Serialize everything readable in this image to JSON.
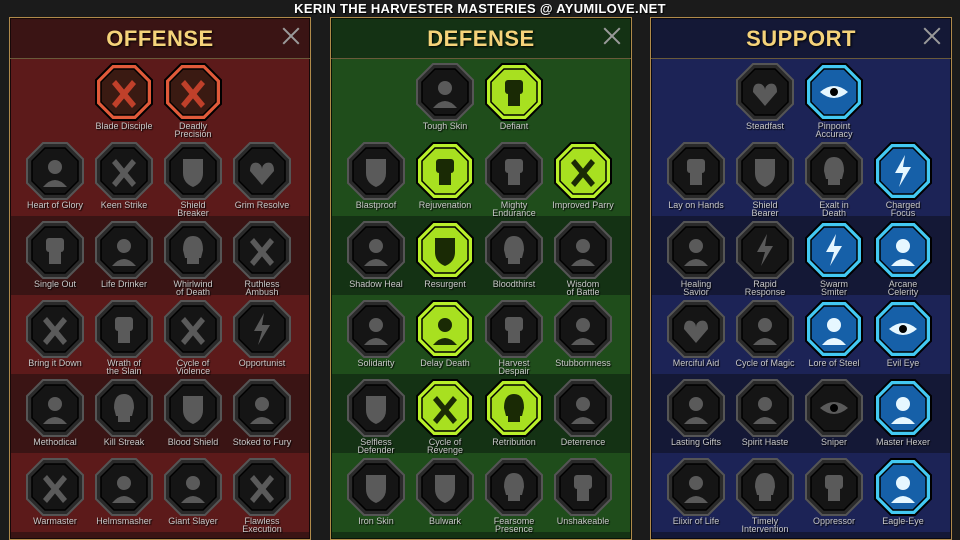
{
  "page_title": "KERIN THE HARVESTER MASTERIES @ AYUMILOVE.NET",
  "panels": [
    {
      "name": "OFFENSE",
      "theme": {
        "bg": "#3a1414",
        "band": "#5c1a1a",
        "accent": "#e05a3a"
      },
      "rows": [
        [
          {
            "label": "Blade Disciple",
            "icon": "crossed-swords-icon",
            "active": true
          },
          {
            "label": "Deadly\nPrecision",
            "icon": "daggers-icon",
            "active": true
          }
        ],
        [
          {
            "label": "Heart of Glory",
            "icon": "horned-warrior-icon",
            "active": false
          },
          {
            "label": "Keen Strike",
            "icon": "slash-icon",
            "active": false
          },
          {
            "label": "Shield\nBreaker",
            "icon": "broken-shield-icon",
            "active": false
          },
          {
            "label": "Grim Resolve",
            "icon": "broken-heart-icon",
            "active": false
          }
        ],
        [
          {
            "label": "Single Out",
            "icon": "target-fist-icon",
            "active": false
          },
          {
            "label": "Life Drinker",
            "icon": "fanged-mouth-icon",
            "active": false
          },
          {
            "label": "Whirlwind\nof Death",
            "icon": "skull-swirl-icon",
            "active": false
          },
          {
            "label": "Ruthless\nAmbush",
            "icon": "raised-blade-icon",
            "active": false
          }
        ],
        [
          {
            "label": "Bring it Down",
            "icon": "sword-down-icon",
            "active": false
          },
          {
            "label": "Wrath of\nthe Slain",
            "icon": "fist-icon",
            "active": false
          },
          {
            "label": "Cycle of\nViolence",
            "icon": "axe-icon",
            "active": false
          },
          {
            "label": "Opportunist",
            "icon": "chain-bolt-icon",
            "active": false
          }
        ],
        [
          {
            "label": "Methodical",
            "icon": "spider-icon",
            "active": false
          },
          {
            "label": "Kill Streak",
            "icon": "skull-icon",
            "active": false
          },
          {
            "label": "Blood Shield",
            "icon": "blood-shield-icon",
            "active": false
          },
          {
            "label": "Stoked to Fury",
            "icon": "rage-figure-icon",
            "active": false
          }
        ],
        [
          {
            "label": "Warmaster",
            "icon": "sword-strike-icon",
            "active": false
          },
          {
            "label": "Helmsmasher",
            "icon": "helmet-icon",
            "active": false
          },
          {
            "label": "Giant Slayer",
            "icon": "giant-icon",
            "active": false
          },
          {
            "label": "Flawless\nExecution",
            "icon": "skull-axe-icon",
            "active": false
          }
        ]
      ]
    },
    {
      "name": "DEFENSE",
      "theme": {
        "bg": "#143214",
        "band": "#1f4d1b",
        "accent": "#b9f02a"
      },
      "rows": [
        [
          {
            "label": "Tough Skin",
            "icon": "scales-icon",
            "active": false
          },
          {
            "label": "Defiant",
            "icon": "raised-fist-icon",
            "active": true
          }
        ],
        [
          {
            "label": "Blastproof",
            "icon": "chevron-shield-icon",
            "active": false
          },
          {
            "label": "Rejuvenation",
            "icon": "healing-hand-icon",
            "active": true
          },
          {
            "label": "Mighty\nEndurance",
            "icon": "strongman-icon",
            "active": false
          },
          {
            "label": "Improved Parry",
            "icon": "crossed-blades-icon",
            "active": true
          }
        ],
        [
          {
            "label": "Shadow Heal",
            "icon": "shadow-figure-icon",
            "active": false
          },
          {
            "label": "Resurgent",
            "icon": "knight-shield-icon",
            "active": true
          },
          {
            "label": "Bloodthirst",
            "icon": "heart-skull-icon",
            "active": false
          },
          {
            "label": "Wisdom\nof Battle",
            "icon": "hooded-sage-icon",
            "active": false
          }
        ],
        [
          {
            "label": "Solidarity",
            "icon": "crowd-icon",
            "active": false
          },
          {
            "label": "Delay Death",
            "icon": "hourglass-icon",
            "active": true
          },
          {
            "label": "Harvest\nDespair",
            "icon": "open-hand-icon",
            "active": false
          },
          {
            "label": "Stubbornness",
            "icon": "bull-icon",
            "active": false
          }
        ],
        [
          {
            "label": "Selfless\nDefender",
            "icon": "shield-runner-icon",
            "active": false
          },
          {
            "label": "Cycle of\nRevenge",
            "icon": "claws-icon",
            "active": true
          },
          {
            "label": "Retribution",
            "icon": "radiant-skull-icon",
            "active": true
          },
          {
            "label": "Deterrence",
            "icon": "deflect-icon",
            "active": false
          }
        ],
        [
          {
            "label": "Iron Skin",
            "icon": "armored-icon",
            "active": false
          },
          {
            "label": "Bulwark",
            "icon": "tower-shield-icon",
            "active": false
          },
          {
            "label": "Fearsome\nPresence",
            "icon": "demon-face-icon",
            "active": false
          },
          {
            "label": "Unshakeable",
            "icon": "brute-icon",
            "active": false
          }
        ]
      ]
    },
    {
      "name": "SUPPORT",
      "theme": {
        "bg": "#141836",
        "band": "#1c2356",
        "accent": "#43c9f2"
      },
      "rows": [
        [
          {
            "label": "Steadfast",
            "icon": "sparkle-heart-icon",
            "active": false
          },
          {
            "label": "Pinpoint\nAccuracy",
            "icon": "target-arrow-icon",
            "active": true
          }
        ],
        [
          {
            "label": "Lay on Hands",
            "icon": "praying-hands-icon",
            "active": false
          },
          {
            "label": "Shield\nBearer",
            "icon": "shield-bearer-icon",
            "active": false
          },
          {
            "label": "Exalt in\nDeath",
            "icon": "flaming-skull-icon",
            "active": false
          },
          {
            "label": "Charged\nFocus",
            "icon": "charged-beam-icon",
            "active": true
          }
        ],
        [
          {
            "label": "Healing\nSavior",
            "icon": "savior-icon",
            "active": false
          },
          {
            "label": "Rapid\nResponse",
            "icon": "lightning-icon",
            "active": false
          },
          {
            "label": "Swarm\nSmiter",
            "icon": "swarm-bolt-icon",
            "active": true
          },
          {
            "label": "Arcane\nCelerity",
            "icon": "afterimage-icon",
            "active": true
          }
        ],
        [
          {
            "label": "Merciful Aid",
            "icon": "chained-heart-icon",
            "active": false
          },
          {
            "label": "Cycle of Magic",
            "icon": "fireball-icon",
            "active": false
          },
          {
            "label": "Lore of Steel",
            "icon": "book-icon",
            "active": true
          },
          {
            "label": "Evil Eye",
            "icon": "evil-eye-icon",
            "active": true
          }
        ],
        [
          {
            "label": "Lasting Gifts",
            "icon": "compass-star-icon",
            "active": false
          },
          {
            "label": "Spirit Haste",
            "icon": "winged-boot-icon",
            "active": false
          },
          {
            "label": "Sniper",
            "icon": "eye-icon",
            "active": false
          },
          {
            "label": "Master Hexer",
            "icon": "hexer-icon",
            "active": true
          }
        ],
        [
          {
            "label": "Elixir of Life",
            "icon": "potion-icon",
            "active": false
          },
          {
            "label": "Timely\nIntervention",
            "icon": "winged-skull-icon",
            "active": false
          },
          {
            "label": "Oppressor",
            "icon": "crushing-fist-icon",
            "active": false
          },
          {
            "label": "Eagle-Eye",
            "icon": "eagle-icon",
            "active": true
          }
        ]
      ]
    }
  ]
}
